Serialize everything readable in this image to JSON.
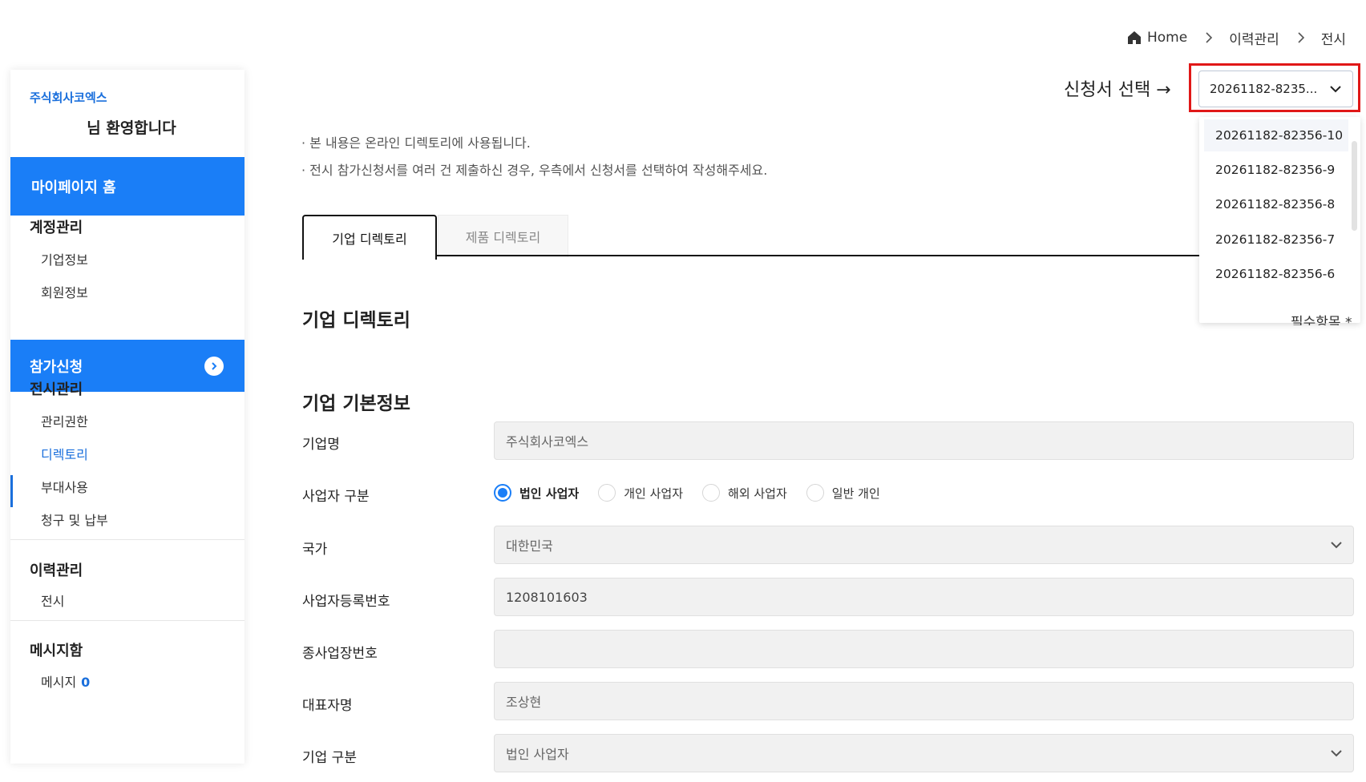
{
  "breadcrumb": {
    "home": "Home",
    "level1": "이력관리",
    "level2": "전시"
  },
  "sidebar": {
    "company": "주식회사코엑스",
    "welcome": "님 환영합니다",
    "mypage_home": "마이페이지 홈",
    "account_section": "계정관리",
    "account_items": [
      "기업정보",
      "회원정보"
    ],
    "apply": "참가신청",
    "exhibit_section": "전시관리",
    "exhibit_items": [
      "관리권한",
      "디렉토리",
      "부대사용",
      "청구 및 납부"
    ],
    "history_section": "이력관리",
    "history_items": [
      "전시"
    ],
    "message_section": "메시지함",
    "message_item": "메시지",
    "message_count": "0"
  },
  "selector": {
    "label": "신청서 선택 →",
    "value": "20261182-8235...",
    "options": [
      "20261182-82356-10",
      "20261182-82356-9",
      "20261182-82356-8",
      "20261182-82356-7",
      "20261182-82356-6"
    ]
  },
  "notices": [
    "· 본 내용은 온라인 디렉토리에 사용됩니다.",
    "· 전시 참가신청서를 여러 건 제출하신 경우, 우측에서 신청서를 선택하여 작성해주세요."
  ],
  "tabs": {
    "company": "기업 디렉토리",
    "product": "제품 디렉토리"
  },
  "main": {
    "directory_title": "기업 디렉토리",
    "partial_right_text": "필수항목 *",
    "basic_info_title": "기업 기본정보"
  },
  "form": {
    "company_name_label": "기업명",
    "company_name_value": "주식회사코엑스",
    "business_type_label": "사업자 구분",
    "business_type_options": [
      "법인 사업자",
      "개인 사업자",
      "해외 사업자",
      "일반 개인"
    ],
    "business_type_selected": "법인 사업자",
    "country_label": "국가",
    "country_value": "대한민국",
    "reg_no_label": "사업자등록번호",
    "reg_no_value": "1208101603",
    "sub_reg_no_label": "종사업장번호",
    "sub_reg_no_value": "",
    "ceo_label": "대표자명",
    "ceo_value": "조상현",
    "company_type_label": "기업 구분",
    "company_type_value": "법인 사업자"
  },
  "colors": {
    "primary": "#1a7ef7",
    "highlight": "#e01818"
  }
}
